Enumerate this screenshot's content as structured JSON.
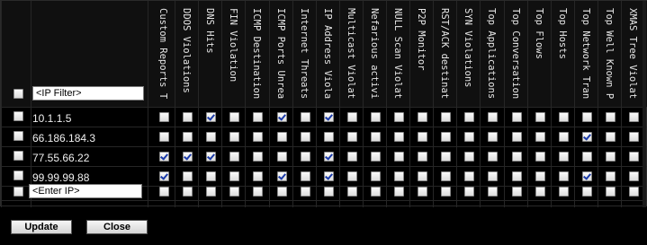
{
  "filter": {
    "ip_filter_placeholder": "<IP Filter>",
    "enter_ip_placeholder": "<Enter IP>"
  },
  "columns": [
    "Custom Reports T",
    "DDOS Violations",
    "DNS Hits",
    "FIN Violation",
    "ICMP Destination",
    "ICMP Ports Unrea",
    "Internet Threats",
    "IP Address Viola",
    "Multicast Violat",
    "Nefarious activi",
    "NULL Scan Violat",
    "P2P Monitor",
    "RST/ACK destinat",
    "SYN Violations",
    "Top Applications",
    "Top Conversation",
    "Top Flows",
    "Top Hosts",
    "Top Network Tran",
    "Top Well Known P",
    "XMAS Tree Violat"
  ],
  "rows": [
    {
      "ip": "10.1.1.5",
      "checks": [
        0,
        0,
        1,
        0,
        0,
        1,
        0,
        1,
        0,
        0,
        0,
        0,
        0,
        0,
        0,
        0,
        0,
        0,
        0,
        0,
        0
      ]
    },
    {
      "ip": "66.186.184.3",
      "checks": [
        0,
        0,
        0,
        0,
        0,
        0,
        0,
        0,
        0,
        0,
        0,
        0,
        0,
        0,
        0,
        0,
        0,
        0,
        1,
        0,
        0
      ]
    },
    {
      "ip": "77.55.66.22",
      "checks": [
        1,
        1,
        1,
        0,
        0,
        0,
        0,
        1,
        0,
        0,
        0,
        0,
        0,
        0,
        0,
        0,
        0,
        0,
        0,
        0,
        0
      ]
    },
    {
      "ip": "99.99.99.88",
      "checks": [
        1,
        0,
        0,
        0,
        0,
        1,
        0,
        1,
        0,
        0,
        0,
        0,
        0,
        0,
        0,
        0,
        0,
        0,
        1,
        0,
        0
      ]
    }
  ],
  "buttons": {
    "update": "Update",
    "close": "Close"
  }
}
